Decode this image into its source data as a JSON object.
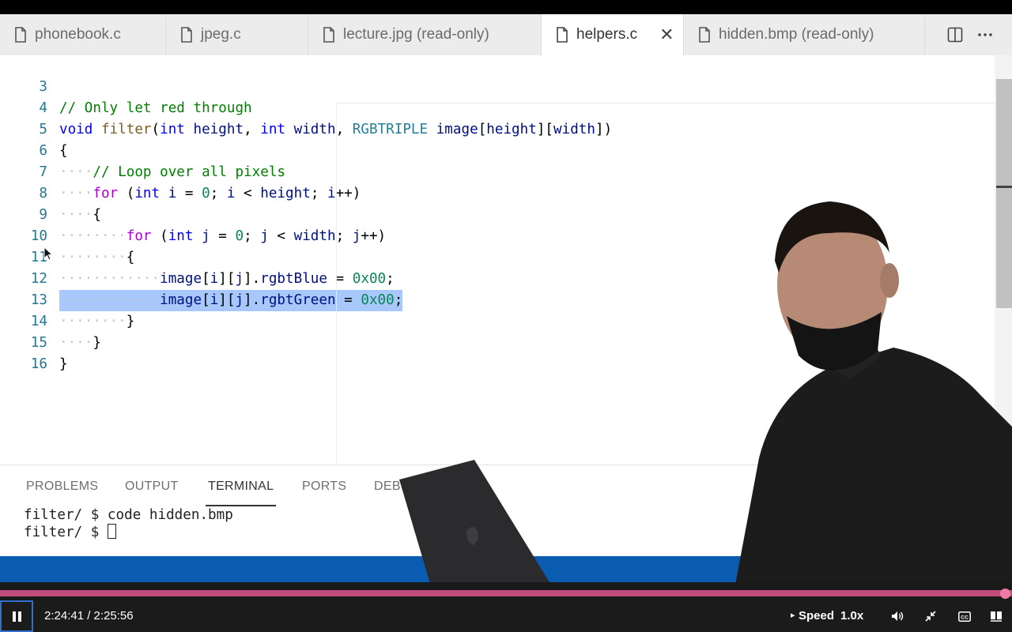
{
  "tabs": [
    {
      "label": "phonebook.c",
      "active": false,
      "icon": "file-icon"
    },
    {
      "label": "jpeg.c",
      "active": false,
      "icon": "file-icon"
    },
    {
      "label": "lecture.jpg (read-only)",
      "active": false,
      "icon": "file-icon"
    },
    {
      "label": "helpers.c",
      "active": true,
      "icon": "file-icon",
      "close": "✕"
    },
    {
      "label": "hidden.bmp (read-only)",
      "active": false,
      "icon": "file-icon"
    }
  ],
  "editor": {
    "lines": [
      {
        "number": "3",
        "text": "// Only let red through"
      },
      {
        "number": "4",
        "text": "void filter(int height, int width, RGBTRIPLE image[height][width])"
      },
      {
        "number": "5",
        "text": "{"
      },
      {
        "number": "6",
        "text": "// Loop over all pixels"
      },
      {
        "number": "7",
        "text": "for (int i = 0; i < height; i++)"
      },
      {
        "number": "8",
        "text": "{"
      },
      {
        "number": "9",
        "text": "for (int j = 0; j < width; j++)"
      },
      {
        "number": "10",
        "text": "{"
      },
      {
        "number": "11",
        "text": "image[i][j].rgbtBlue = 0x00;"
      },
      {
        "number": "12",
        "text": "image[i][j].rgbtGreen = 0x00;",
        "selected": true
      },
      {
        "number": "13",
        "text": "}"
      },
      {
        "number": "14",
        "text": "}"
      },
      {
        "number": "15",
        "text": "}"
      },
      {
        "number": "16",
        "text": ""
      }
    ]
  },
  "panel": {
    "tabs": [
      "PROBLEMS",
      "OUTPUT",
      "TERMINAL",
      "PORTS",
      "DEBU"
    ],
    "active_tab": "TERMINAL",
    "terminal_lines": [
      "filter/ $ code hidden.bmp",
      "filter/ $ "
    ]
  },
  "player": {
    "time": "2:24:41 / 2:25:56",
    "speed_label": "Speed",
    "speed_value": "1.0x",
    "progress": 0.9915,
    "accent": "#c04d7b"
  },
  "colors": {
    "statusbar": "#0a5cb1",
    "selection": "#a8c7fa"
  }
}
